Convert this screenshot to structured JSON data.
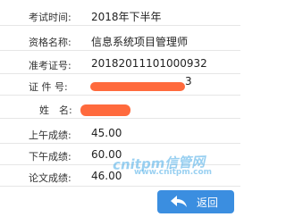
{
  "rows": [
    {
      "label": "考试时间:",
      "value": "2018年下半年"
    },
    {
      "label": "资格名称:",
      "value": "信息系统项目管理师"
    },
    {
      "label": "准考证号:",
      "value": "20182011101000932"
    },
    {
      "label": "证 件 号:",
      "value": "",
      "suffix": "3"
    },
    {
      "label": "姓　名:",
      "value": ""
    },
    {
      "label": "上午成绩:",
      "value": "45.00"
    },
    {
      "label": "下午成绩:",
      "value": "60.00"
    },
    {
      "label": "论文成绩:",
      "value": "46.00"
    }
  ],
  "watermark": {
    "main": "cnitpm信管网",
    "sub": "www.cnitpm.com"
  },
  "back_button": {
    "label": "返回",
    "icon": "back-arrow-icon"
  },
  "colors": {
    "redaction": "#ff6a3d",
    "button": "#3b8ee0",
    "watermark": "#46aae6"
  }
}
